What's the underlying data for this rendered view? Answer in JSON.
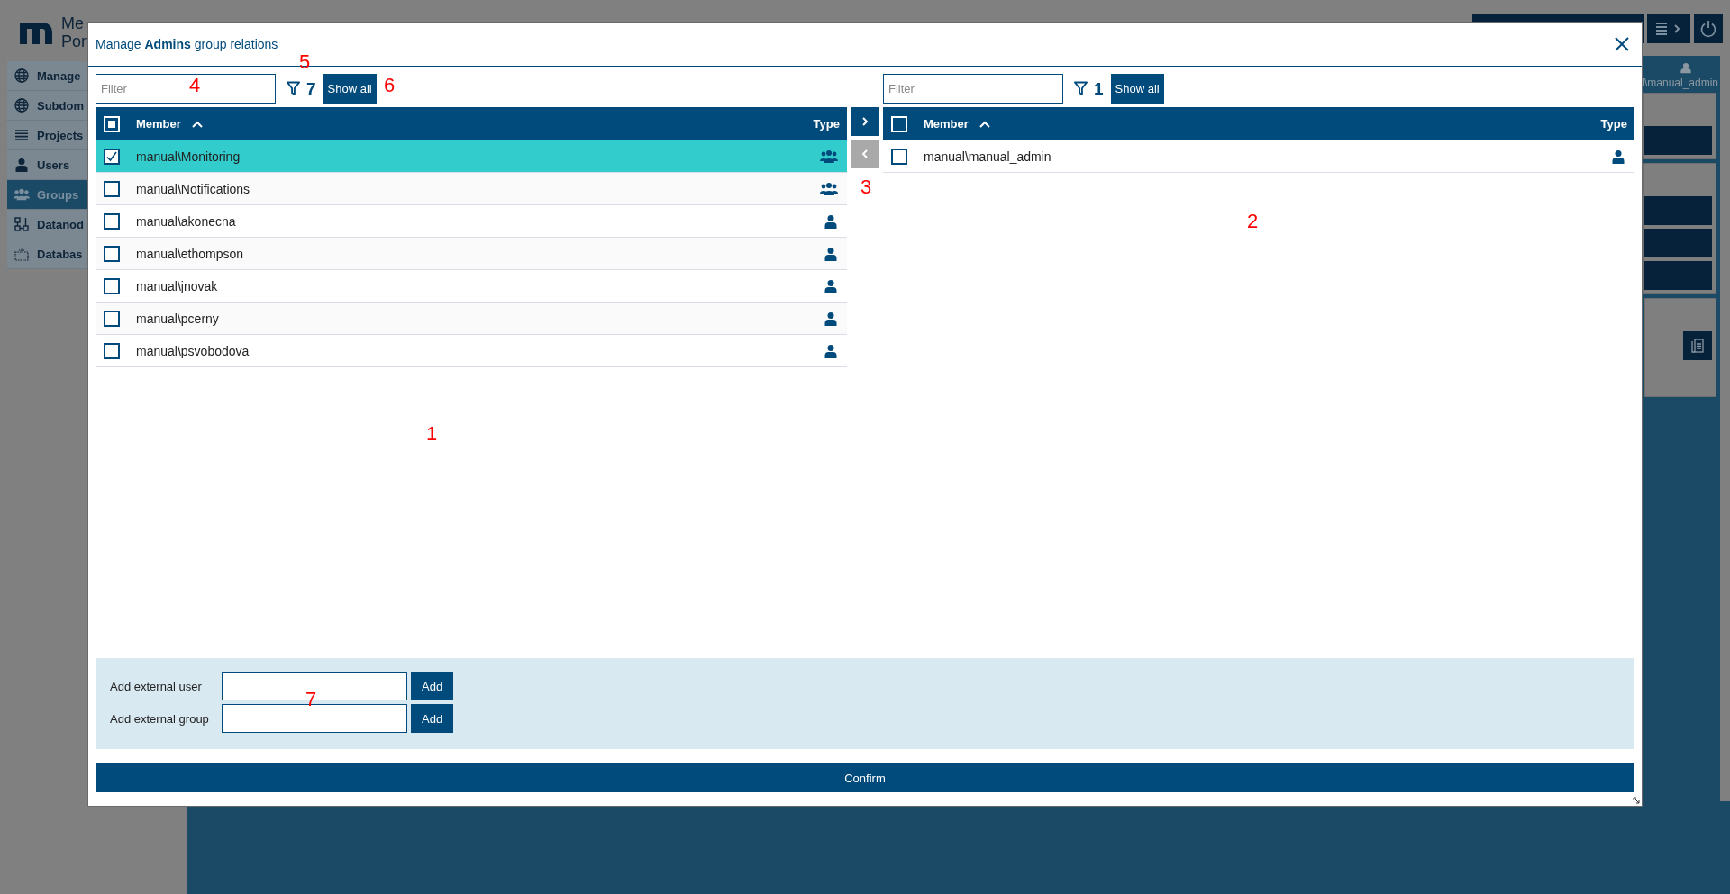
{
  "background": {
    "logo_lines": [
      "Me",
      "Por"
    ],
    "nav": [
      {
        "label": "Manage",
        "kind": "globe",
        "selected": false
      },
      {
        "label": "Subdom",
        "kind": "globe",
        "selected": false
      },
      {
        "label": "Projects",
        "kind": "list",
        "selected": false
      },
      {
        "label": "Users",
        "kind": "user",
        "selected": false
      },
      {
        "label": "Groups",
        "kind": "group",
        "selected": true
      },
      {
        "label": "Datanod",
        "kind": "nodes",
        "selected": false
      },
      {
        "label": "Databas",
        "kind": "database",
        "selected": false
      }
    ],
    "user": "l\\manual_admin"
  },
  "dialog": {
    "title": "Manage **Admins** group relations",
    "left": {
      "filter": {
        "placeholder": "Filter"
      },
      "count": "7",
      "show_all": "Show all",
      "select_all_partial": true,
      "columns": [
        "Member",
        "Type"
      ],
      "rows": [
        {
          "member": "manual\\Monitoring",
          "kind": "group",
          "checked": true,
          "selected": true
        },
        {
          "member": "manual\\Notifications",
          "kind": "group",
          "checked": false,
          "selected": false
        },
        {
          "member": "manual\\akonecna",
          "kind": "user",
          "checked": false,
          "selected": false
        },
        {
          "member": "manual\\ethompson",
          "kind": "user",
          "checked": false,
          "selected": false
        },
        {
          "member": "manual\\jnovak",
          "kind": "user",
          "checked": false,
          "selected": false
        },
        {
          "member": "manual\\pcerny",
          "kind": "user",
          "checked": false,
          "selected": false
        },
        {
          "member": "manual\\psvobodova",
          "kind": "user",
          "checked": false,
          "selected": false
        }
      ]
    },
    "move_right": {
      "disabled": false
    },
    "move_left": {
      "disabled": true
    },
    "right": {
      "filter": {
        "placeholder": "Filter"
      },
      "count": "1",
      "show_all": "Show all",
      "select_all_partial": false,
      "columns": [
        "Member",
        "Type"
      ],
      "rows": [
        {
          "member": "manual\\manual_admin",
          "kind": "user",
          "checked": false,
          "selected": false
        }
      ]
    },
    "external": [
      {
        "label": "Add external user",
        "button": "Add"
      },
      {
        "label": "Add external group",
        "button": "Add"
      }
    ],
    "confirm": "Confirm"
  },
  "annotations": [
    "1",
    "2",
    "3",
    "4",
    "5",
    "6",
    "7"
  ]
}
